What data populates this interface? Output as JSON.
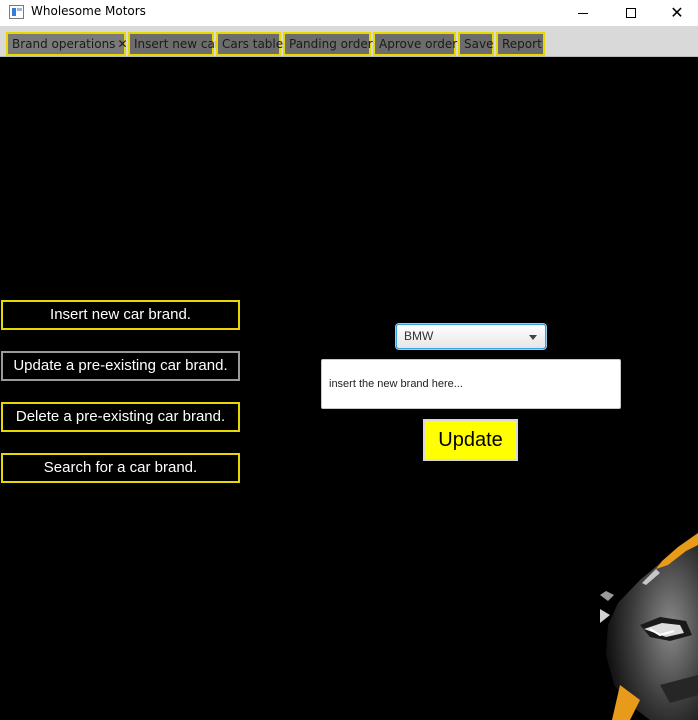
{
  "window": {
    "title": "Wholesome Motors"
  },
  "tabs": [
    {
      "label": "Brand operations",
      "closable": true
    },
    {
      "label": "Insert new car"
    },
    {
      "label": "Cars table"
    },
    {
      "label": "Panding order"
    },
    {
      "label": "Aprove order"
    },
    {
      "label": "Save"
    },
    {
      "label": "Report"
    }
  ],
  "side_menu": {
    "insert_label": "Insert new car brand.",
    "update_label": "Update a pre-existing car brand.",
    "delete_label": "Delete a pre-existing car brand.",
    "search_label": "Search for a car brand."
  },
  "form": {
    "brand_select_value": "BMW",
    "new_brand_placeholder": "insert the new brand here...",
    "update_button_label": "Update"
  },
  "colors": {
    "accent_yellow": "#ffff00",
    "tab_border": "#e6d800",
    "background": "#000000"
  },
  "icons": {
    "app": "app-window-icon",
    "minimize": "minimize-icon",
    "maximize": "maximize-icon",
    "close": "close-icon",
    "dropdown": "chevron-down-icon"
  }
}
